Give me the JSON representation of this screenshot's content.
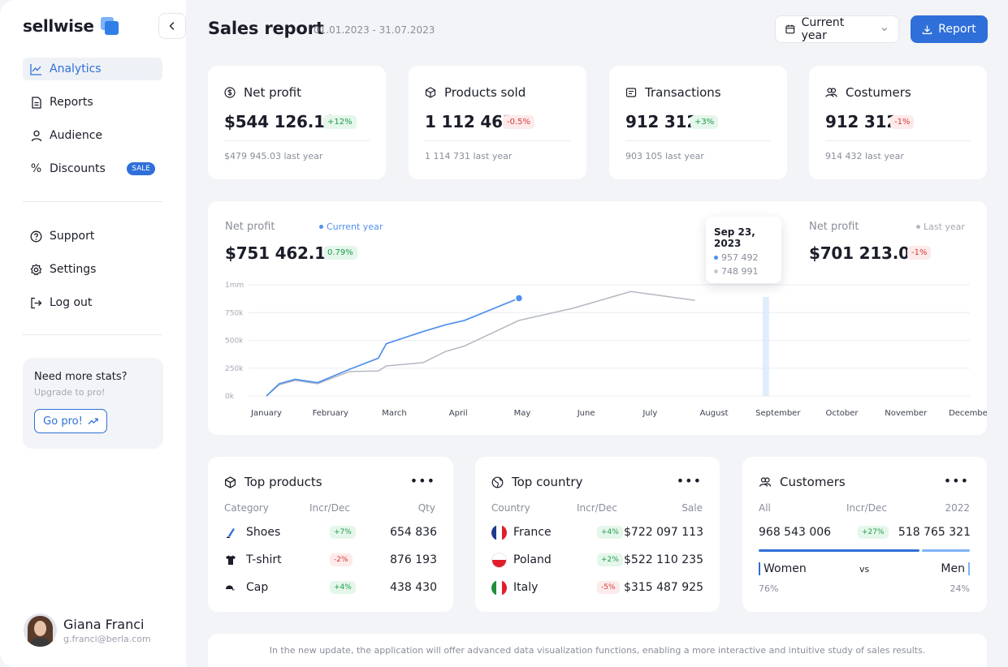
{
  "app": {
    "brand": "sellwise"
  },
  "sidebar": {
    "nav_primary": [
      {
        "label": "Analytics",
        "icon": "chart-line-icon",
        "active": true
      },
      {
        "label": "Reports",
        "icon": "document-icon"
      },
      {
        "label": "Audience",
        "icon": "user-icon"
      },
      {
        "label": "Discounts",
        "icon": "percent-icon",
        "badge": "SALE"
      }
    ],
    "nav_secondary": [
      {
        "label": "Support",
        "icon": "help-icon"
      },
      {
        "label": "Settings",
        "icon": "gear-icon"
      },
      {
        "label": "Log out",
        "icon": "logout-icon"
      }
    ],
    "promo": {
      "title": "Need more stats?",
      "subtitle": "Upgrade to pro!",
      "button": "Go pro!"
    },
    "user": {
      "name": "Giana Franci",
      "email": "g.franci@berla.com"
    }
  },
  "header": {
    "title": "Sales report",
    "date_range": "01.01.2023 - 31.07.2023",
    "period_select": "Current year",
    "report_button": "Report"
  },
  "kpis": [
    {
      "title": "Net profit",
      "icon": "dollar-circle-icon",
      "value": "$544 126.19",
      "change": "+12%",
      "trend": "up",
      "last_year": "$479 945.03 last year"
    },
    {
      "title": "Products sold",
      "icon": "box-icon",
      "value": "1 112 462",
      "change": "-0.5%",
      "trend": "down",
      "last_year": "1 114 731 last year"
    },
    {
      "title": "Transactions",
      "icon": "receipt-icon",
      "value": "912 312",
      "change": "+3%",
      "trend": "up",
      "last_year": "903 105 last year"
    },
    {
      "title": "Costumers",
      "icon": "users-icon",
      "value": "912 312",
      "change": "-1%",
      "trend": "down",
      "last_year": "914 432 last year"
    }
  ],
  "net_profit_chart": {
    "current": {
      "label": "Net profit",
      "legend": "Current year",
      "value": "$751 462.12",
      "change": "0.79%"
    },
    "previous": {
      "label": "Net profit",
      "legend": "Last year",
      "value": "$701 213.09",
      "change": "-1%"
    },
    "tooltip": {
      "date": "Sep 23, 2023",
      "current": "957 492",
      "previous": "748 991"
    }
  },
  "chart_data": {
    "type": "line",
    "categories": [
      "January",
      "February",
      "March",
      "April",
      "May",
      "June",
      "July",
      "August",
      "September",
      "October",
      "November",
      "December"
    ],
    "y_ticks": [
      "1mm",
      "750k",
      "500k",
      "250k",
      "0k"
    ],
    "ylim": [
      0,
      1000000
    ],
    "series": [
      {
        "name": "Current year",
        "color": "#4f8ff0",
        "x": [
          0,
          0.4,
          0.9,
          1.6,
          2.6,
          3.5,
          3.75,
          4.9,
          5.6,
          6.2,
          7.9
        ],
        "values": [
          0,
          110000,
          150000,
          120000,
          240000,
          340000,
          470000,
          580000,
          640000,
          680000,
          880000
        ]
      },
      {
        "name": "Last year",
        "color": "#b4b8c2",
        "x": [
          0,
          0.4,
          0.9,
          1.6,
          2.6,
          3.5,
          3.75,
          4.9,
          5.6,
          6.2,
          7.9,
          9.6,
          11.4,
          13.4
        ],
        "values": [
          0,
          100000,
          140000,
          110000,
          220000,
          225000,
          270000,
          300000,
          400000,
          450000,
          680000,
          790000,
          940000,
          860000
        ]
      }
    ]
  },
  "top_products": {
    "title": "Top products",
    "columns": [
      "Category",
      "Incr/Dec",
      "Qty"
    ],
    "rows": [
      {
        "name": "Shoes",
        "icon": "shoe-icon",
        "change": "+7%",
        "trend": "up",
        "qty": "654 836"
      },
      {
        "name": "T-shirt",
        "icon": "tshirt-icon",
        "change": "-2%",
        "trend": "down",
        "qty": "876 193"
      },
      {
        "name": "Cap",
        "icon": "cap-icon",
        "change": "+4%",
        "trend": "up",
        "qty": "438 430"
      }
    ]
  },
  "top_country": {
    "title": "Top country",
    "columns": [
      "Country",
      "Incr/Dec",
      "Sale"
    ],
    "rows": [
      {
        "name": "France",
        "flag": "france-flag-icon",
        "change": "+4%",
        "trend": "up",
        "sale": "$722 097 113"
      },
      {
        "name": "Poland",
        "flag": "poland-flag-icon",
        "change": "+2%",
        "trend": "up",
        "sale": "$522 110 235"
      },
      {
        "name": "Italy",
        "flag": "italy-flag-icon",
        "change": "-5%",
        "trend": "down",
        "sale": "$315 487 925"
      }
    ]
  },
  "customers": {
    "title": "Customers",
    "columns": [
      "All",
      "Incr/Dec",
      "2022"
    ],
    "all": "968 543 006",
    "change": "+27%",
    "prev": "518 765 321",
    "women_label": "Women",
    "vs_label": "vs",
    "men_label": "Men",
    "women_pct": "76%",
    "men_pct": "24%",
    "women_share": 0.76
  },
  "notice": "In the new update, the application will offer advanced data visualization functions, enabling a more interactive and intuitive study of sales results.",
  "colors": {
    "accent": "#2f6fd9",
    "current_series": "#4f8ff0",
    "last_series": "#b4b8c2",
    "positive": "#1e9c4c",
    "negative": "#d83a3a"
  }
}
